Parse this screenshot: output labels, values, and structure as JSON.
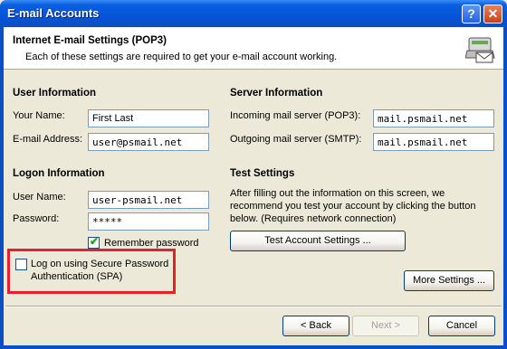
{
  "window": {
    "title": "E-mail Accounts",
    "help_glyph": "?",
    "close_glyph": "✕"
  },
  "header": {
    "title": "Internet E-mail Settings (POP3)",
    "subtitle": "Each of these settings are required to get your e-mail account working."
  },
  "user_info": {
    "heading": "User Information",
    "name_label": "Your Name:",
    "name_value": "First Last",
    "email_label": "E-mail Address:",
    "email_value": "user@psmail.net"
  },
  "server_info": {
    "heading": "Server Information",
    "incoming_label": "Incoming mail server (POP3):",
    "incoming_value": "mail.psmail.net",
    "outgoing_label": "Outgoing mail server (SMTP):",
    "outgoing_value": "mail.psmail.net"
  },
  "logon_info": {
    "heading": "Logon Information",
    "username_label": "User Name:",
    "username_value": "user-psmail.net",
    "password_label": "Password:",
    "password_value": "*****",
    "remember_label": "Remember password",
    "remember_checked": true,
    "spa_label_line1": "Log on using Secure Password",
    "spa_label_line2": "Authentication (SPA)",
    "spa_checked": false
  },
  "test_settings": {
    "heading": "Test Settings",
    "description_line1": "After filling out the information on this screen, we",
    "description_line2": "recommend you test your account by clicking the button",
    "description_line3": "below. (Requires network connection)",
    "test_button": "Test Account Settings ..."
  },
  "buttons": {
    "more_settings": "More Settings ...",
    "back": "< Back",
    "next": "Next >",
    "cancel": "Cancel"
  },
  "colors": {
    "titlebar": "#0554D8",
    "dialog_bg": "#ECE9D8",
    "highlight": "#E3202C"
  },
  "icons": {
    "header": "mail-server-icon"
  }
}
